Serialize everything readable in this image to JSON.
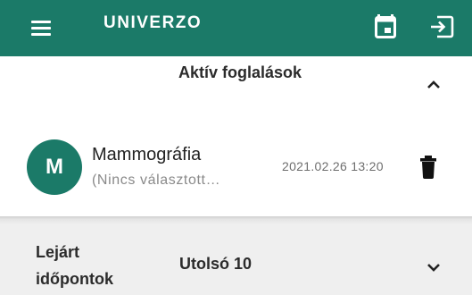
{
  "appbar": {
    "title": "UNIVERZO",
    "menu_icon": "menu-icon",
    "calendar_icon": "calendar-icon",
    "logout_icon": "logout-icon",
    "color": "#1b7a68"
  },
  "active_section": {
    "title": "Aktív foglalások",
    "expand_icon": "chevron-up-icon",
    "bookings": [
      {
        "avatar_letter": "M",
        "name": "Mammográfia",
        "subtitle": "(Nincs választott…",
        "datetime": "2021.02.26 13:20",
        "action_icon": "trash-icon"
      }
    ]
  },
  "expired_section": {
    "title": "Lejárt időpontok",
    "filter_label": "Utolsó 10",
    "expand_icon": "chevron-down-icon"
  }
}
